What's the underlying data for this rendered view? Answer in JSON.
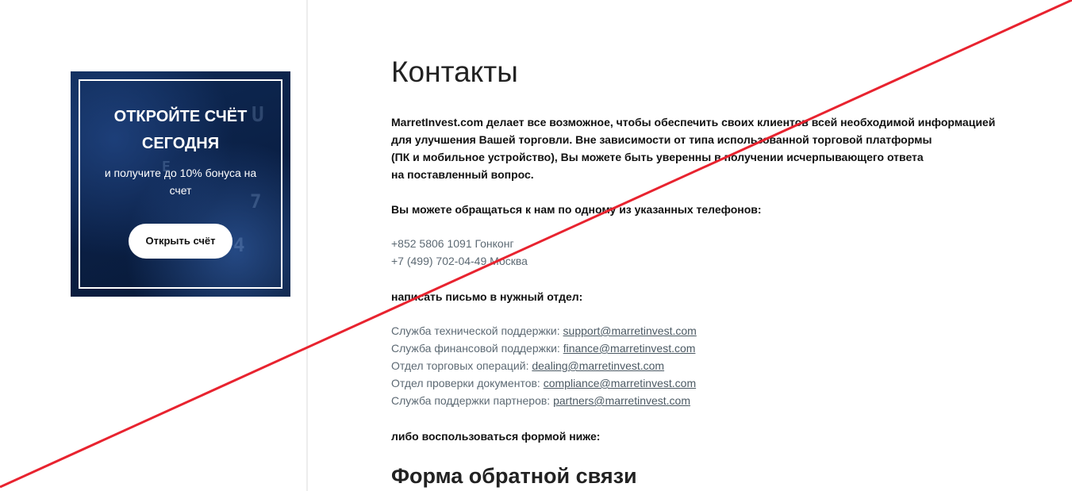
{
  "promo": {
    "title_line1": "ОТКРОЙТЕ СЧЁТ",
    "title_line2": "СЕГОДНЯ",
    "subtitle": "и получите до 10% бонуса на счет",
    "button_label": "Открыть счёт"
  },
  "main": {
    "title": "Контакты",
    "intro_lines": [
      "MarretInvest.com делает все возможное, чтобы обеспечить своих клиентов всей необходимой информацией",
      "для улучшения Вашей торговли. Вне зависимости от типа использованной торговой платформы",
      "(ПК и мобильное устройство), Вы можете быть уверенны в получении исчерпывающего ответа",
      "на поставленный вопрос."
    ],
    "phones_heading": "Вы можете обращаться к нам по одному из указанных телефонов:",
    "phones": [
      "+852 5806 1091 Гонконг",
      "+7 (499) 702-04-49 Москва"
    ],
    "email_heading": "написать письмо в нужный отдел:",
    "emails": [
      {
        "label": "Служба технической поддержки: ",
        "address": "support@marretinvest.com"
      },
      {
        "label": "Служба финансовой поддержки: ",
        "address": "finance@marretinvest.com"
      },
      {
        "label": "Отдел торговых операций: ",
        "address": "dealing@marretinvest.com"
      },
      {
        "label": "Отдел проверки документов: ",
        "address": "compliance@marretinvest.com"
      },
      {
        "label": "Служба поддержки партнеров: ",
        "address": "partners@marretinvest.com"
      }
    ],
    "form_note": "либо воспользоваться формой ниже:",
    "form_title": "Форма обратной связи"
  },
  "overlay": {
    "strike_color": "#e8232f"
  }
}
